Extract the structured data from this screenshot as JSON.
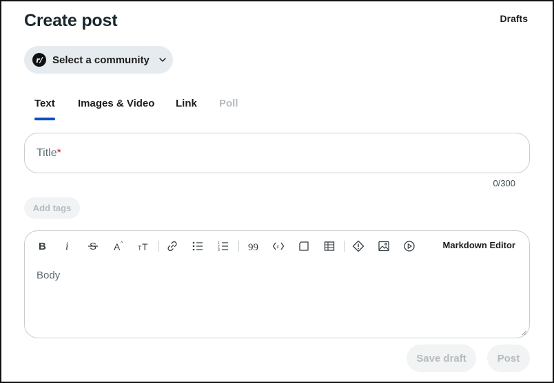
{
  "header": {
    "title": "Create post",
    "drafts_label": "Drafts"
  },
  "community_selector": {
    "icon_letter": "r/",
    "label": "Select a community",
    "icon": "chevron-down-icon"
  },
  "tabs": [
    {
      "label": "Text",
      "active": true,
      "disabled": false
    },
    {
      "label": "Images & Video",
      "active": false,
      "disabled": false
    },
    {
      "label": "Link",
      "active": false,
      "disabled": false
    },
    {
      "label": "Poll",
      "active": false,
      "disabled": true
    }
  ],
  "title_field": {
    "placeholder": "Title",
    "required_mark": "*",
    "char_count": "0/300"
  },
  "tags": {
    "label": "Add tags"
  },
  "editor": {
    "toolbar": [
      "bold-icon",
      "italic-icon",
      "strikethrough-icon",
      "superscript-icon",
      "heading-icon",
      "link-icon",
      "bulleted-list-icon",
      "numbered-list-icon",
      "quote-icon",
      "code-icon",
      "code-block-icon",
      "table-icon",
      "spoiler-icon",
      "image-icon",
      "video-icon"
    ],
    "markdown_label": "Markdown Editor",
    "body_placeholder": "Body"
  },
  "actions": {
    "save_draft_label": "Save draft",
    "post_label": "Post"
  },
  "colors": {
    "accent": "#0a4ec4",
    "pill_background": "#e5ebee",
    "disabled_text": "#b5bcbf",
    "required": "#c4232b"
  }
}
